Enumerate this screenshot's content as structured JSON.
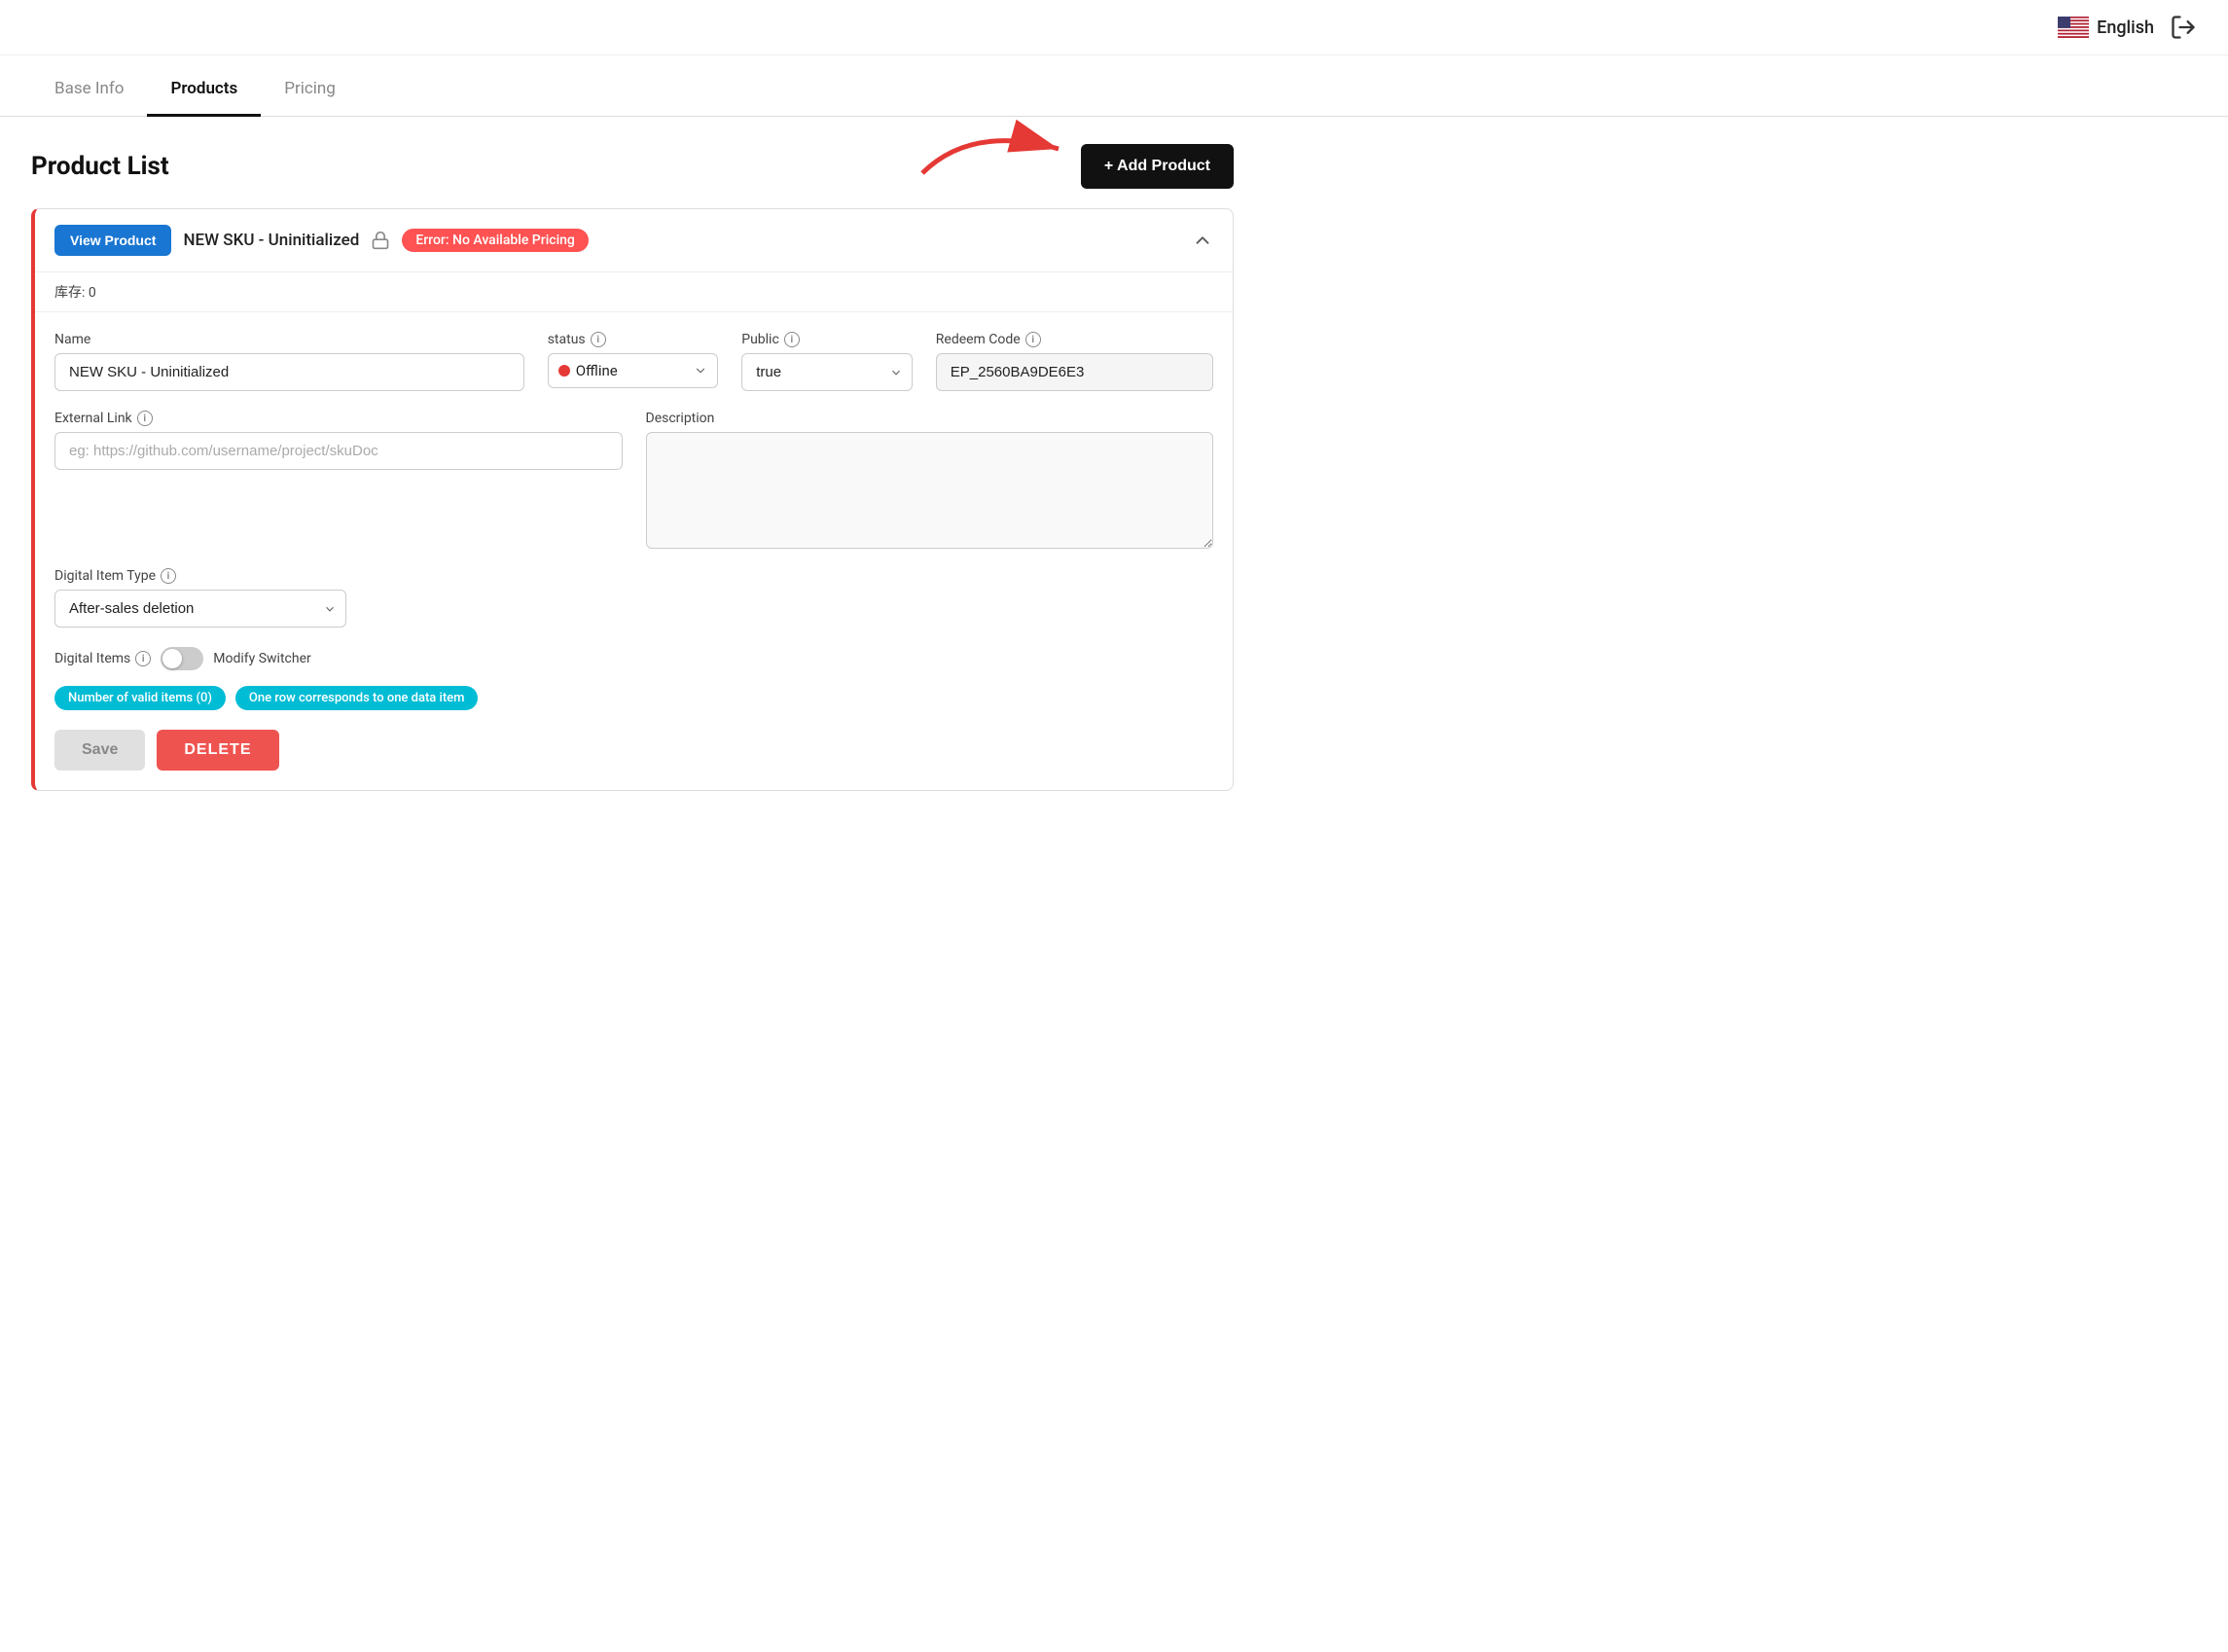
{
  "header": {
    "language": "English",
    "logout_icon": "logout-icon"
  },
  "tabs": [
    {
      "id": "base-info",
      "label": "Base Info",
      "active": false
    },
    {
      "id": "products",
      "label": "Products",
      "active": true
    },
    {
      "id": "pricing",
      "label": "Pricing",
      "active": false
    }
  ],
  "page_title": "Product List",
  "add_product_btn": "+ Add Product",
  "product": {
    "view_btn": "View Product",
    "sku_name": "NEW SKU - Uninitialized",
    "error_badge": "Error: No Available Pricing",
    "stock_label": "库存: 0",
    "form": {
      "name_label": "Name",
      "name_value": "NEW SKU - Uninitialized",
      "status_label": "status",
      "status_value": "Offline",
      "public_label": "Public",
      "public_value": "true",
      "redeem_code_label": "Redeem Code",
      "redeem_code_value": "EP_2560BA9DE6E3",
      "external_link_label": "External Link",
      "external_link_placeholder": "eg: https://github.com/username/project/skuDoc",
      "description_label": "Description",
      "description_value": "",
      "digital_item_type_label": "Digital Item Type",
      "digital_item_type_value": "After-sales deletion",
      "digital_items_label": "Digital Items",
      "modify_switcher_label": "Modify Switcher",
      "badge_valid_items": "Number of valid items (0)",
      "badge_row_info": "One row corresponds to one data item",
      "save_btn": "Save",
      "delete_btn": "DELETE"
    }
  }
}
